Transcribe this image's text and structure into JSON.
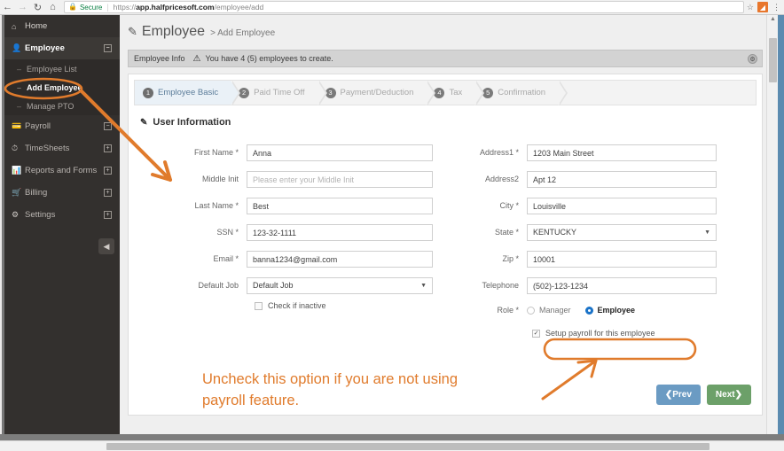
{
  "browser": {
    "back_icon": "arrow-left-icon",
    "forward_icon": "arrow-right-icon",
    "reload_icon": "reload-icon",
    "home_icon": "home-icon",
    "lock_icon": "lock-icon",
    "secure_label": "Secure",
    "url_scheme": "https://",
    "url_host": "app.halfpricesoft.com",
    "url_path": "/employee/add",
    "star_icon": "star-icon",
    "extension_icon": "extension-icon",
    "menu_icon": "three-dots-menu-icon"
  },
  "sidebar": {
    "items": [
      {
        "label": "Home",
        "icon": "home-icon",
        "expander": "",
        "active": false
      },
      {
        "label": "Employee",
        "icon": "user-icon",
        "expander": "−",
        "active": true
      },
      {
        "label": "Payroll",
        "icon": "payroll-icon",
        "expander": "−",
        "active": false
      },
      {
        "label": "TimeSheets",
        "icon": "clock-icon",
        "expander": "+",
        "active": false
      },
      {
        "label": "Reports and Forms",
        "icon": "chart-icon",
        "expander": "+",
        "active": false
      },
      {
        "label": "Billing",
        "icon": "cart-icon",
        "expander": "+",
        "active": false
      },
      {
        "label": "Settings",
        "icon": "gear-icon",
        "expander": "+",
        "active": false
      }
    ],
    "submenu": [
      {
        "label": "Employee List",
        "highlight": false
      },
      {
        "label": "Add Employee",
        "highlight": true
      },
      {
        "label": "Manage PTO",
        "highlight": false
      }
    ],
    "collapse_icon": "collapse-left-icon"
  },
  "header": {
    "pencil_icon": "pencil-square-icon",
    "title": "Employee",
    "breadcrumb": "> Add Employee"
  },
  "info_bar": {
    "label": "Employee Info",
    "warning_icon": "warning-triangle-icon",
    "message": "You have 4 (5) employees to create.",
    "gear_icon": "gear-icon"
  },
  "steps": [
    {
      "num": "1",
      "label": "Employee Basic",
      "current": true
    },
    {
      "num": "2",
      "label": "Paid Time Off",
      "current": false
    },
    {
      "num": "3",
      "label": "Payment/Deduction",
      "current": false
    },
    {
      "num": "4",
      "label": "Tax",
      "current": false
    },
    {
      "num": "5",
      "label": "Confirmation",
      "current": false
    }
  ],
  "section": {
    "pencil_icon": "pencil-icon",
    "title": "User Information"
  },
  "form": {
    "left": [
      {
        "label": "First Name",
        "required": true,
        "value": "Anna",
        "placeholder": "",
        "type": "text"
      },
      {
        "label": "Middle Init",
        "required": false,
        "value": "",
        "placeholder": "Please enter your Middle Init",
        "type": "text"
      },
      {
        "label": "Last Name",
        "required": true,
        "value": "Best",
        "placeholder": "",
        "type": "text"
      },
      {
        "label": "SSN",
        "required": true,
        "value": "123-32-1111",
        "placeholder": "",
        "type": "text"
      },
      {
        "label": "Email",
        "required": true,
        "value": "banna1234@gmail.com",
        "placeholder": "",
        "type": "text"
      },
      {
        "label": "Default Job",
        "required": false,
        "value": "Default Job",
        "placeholder": "",
        "type": "select"
      }
    ],
    "right": [
      {
        "label": "Address1",
        "required": true,
        "value": "1203 Main Street",
        "placeholder": "",
        "type": "text"
      },
      {
        "label": "Address2",
        "required": false,
        "value": "Apt 12",
        "placeholder": "",
        "type": "text"
      },
      {
        "label": "City",
        "required": true,
        "value": "Louisville",
        "placeholder": "",
        "type": "text"
      },
      {
        "label": "State",
        "required": true,
        "value": "KENTUCKY",
        "placeholder": "",
        "type": "select"
      },
      {
        "label": "Zip",
        "required": true,
        "value": "10001",
        "placeholder": "",
        "type": "text"
      },
      {
        "label": "Telephone",
        "required": false,
        "value": "(502)-123-1234",
        "placeholder": "",
        "type": "text"
      }
    ],
    "inactive_checkbox": {
      "label": "Check if inactive",
      "checked": false
    },
    "role": {
      "label": "Role",
      "required": true,
      "options": [
        {
          "label": "Manager",
          "selected": false
        },
        {
          "label": "Employee",
          "selected": true
        }
      ]
    },
    "payroll_checkbox": {
      "label": "Setup payroll for this employee",
      "checked": true
    }
  },
  "buttons": {
    "prev": "Prev",
    "next": "Next",
    "prev_icon": "arrow-left-icon",
    "next_icon": "arrow-right-icon"
  },
  "annotation": {
    "note_line1": "Uncheck this option if you are not using",
    "note_line2": "payroll feature."
  },
  "colors": {
    "annotation_orange": "#e07b2c",
    "sidebar_bg": "#33302e",
    "next_green": "#6ca069",
    "prev_blue": "#6b9bc3",
    "radio_blue": "#1a73c8",
    "secure_green": "#0b8043"
  }
}
